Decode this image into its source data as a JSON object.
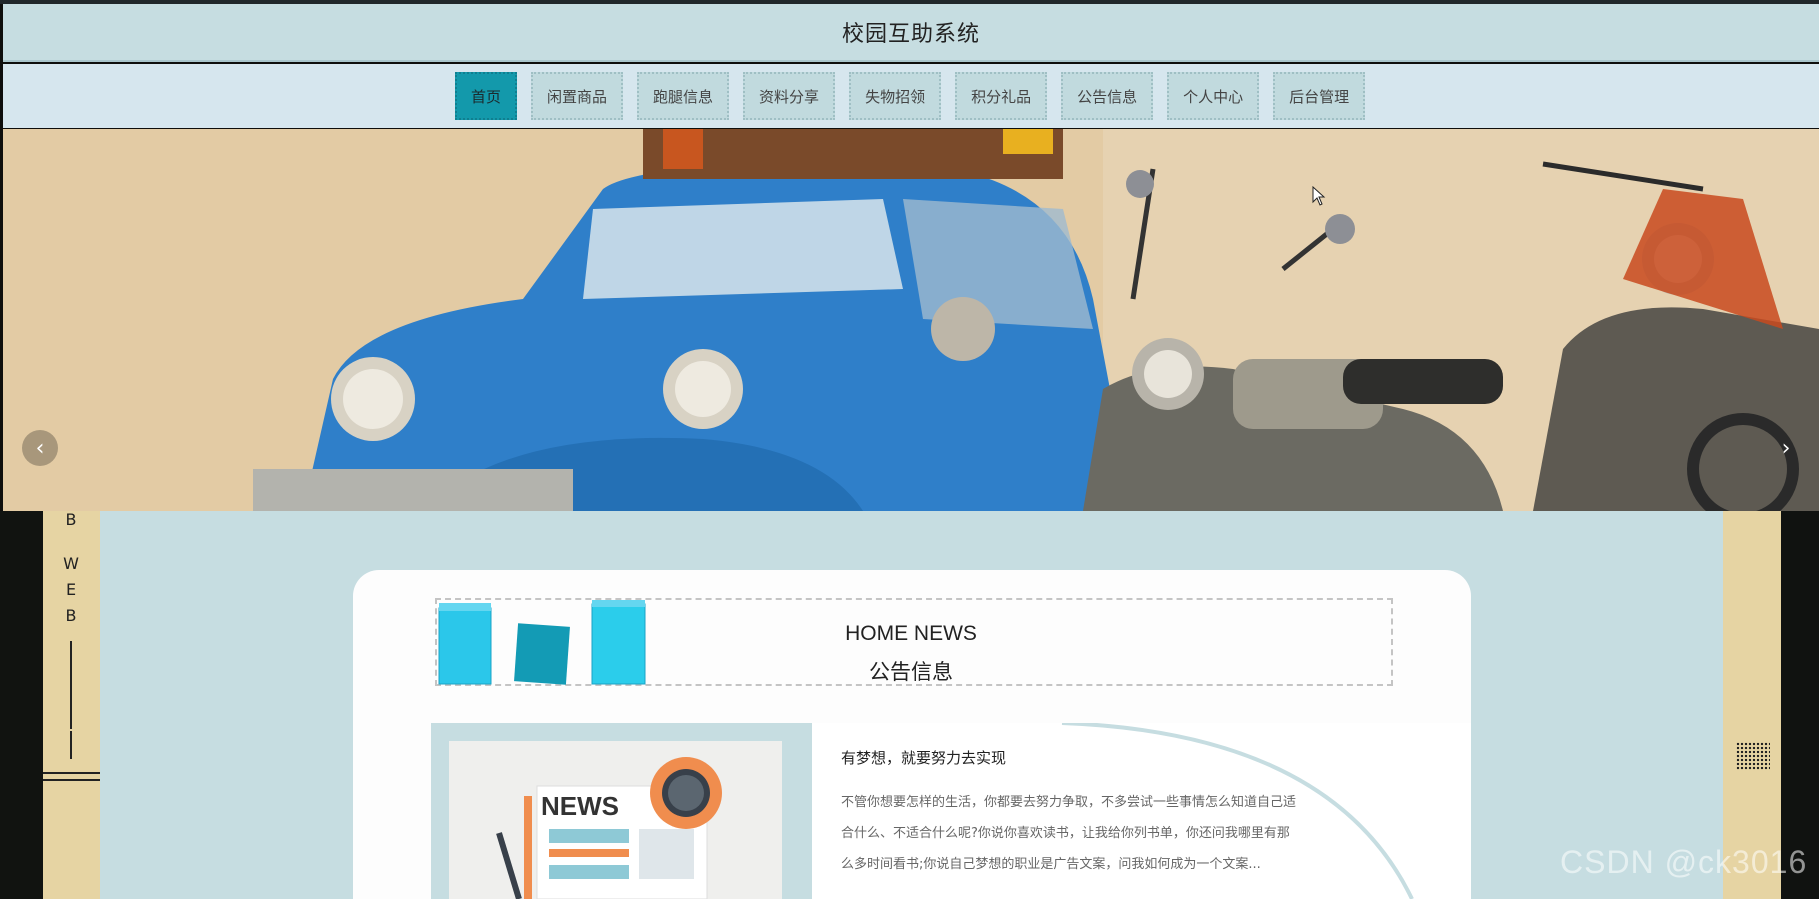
{
  "header": {
    "title": "校园互助系统"
  },
  "nav": {
    "items": [
      {
        "label": "首页"
      },
      {
        "label": "闲置商品"
      },
      {
        "label": "跑腿信息"
      },
      {
        "label": "资料分享"
      },
      {
        "label": "失物招领"
      },
      {
        "label": "积分礼品"
      },
      {
        "label": "公告信息"
      },
      {
        "label": "个人中心"
      },
      {
        "label": "后台管理"
      }
    ],
    "active_index": 0
  },
  "carousel": {
    "prev_icon": "chevron-left-icon",
    "next_icon": "chevron-right-icon"
  },
  "side_decoration": {
    "letters": [
      "B",
      "W",
      "E",
      "B"
    ]
  },
  "news_section": {
    "title_en": "HOME NEWS",
    "title_cn": "公告信息",
    "item": {
      "title": "有梦想，就要努力去实现",
      "text": "不管你想要怎样的生活，你都要去努力争取，不多尝试一些事情怎么知道自己适合什么、不适合什么呢?你说你喜欢读书，让我给你列书单，你还问我哪里有那么多时间看书;你说自己梦想的职业是广告文案，问我如何成为一个文案...",
      "image_label": "NEWS"
    }
  },
  "watermark": "CSDN @ck3016",
  "colors": {
    "accent": "#1399ab",
    "header_bg": "#c6dde1",
    "nav_bg": "#d6e6ee",
    "side_strip": "#e6d4a3"
  }
}
